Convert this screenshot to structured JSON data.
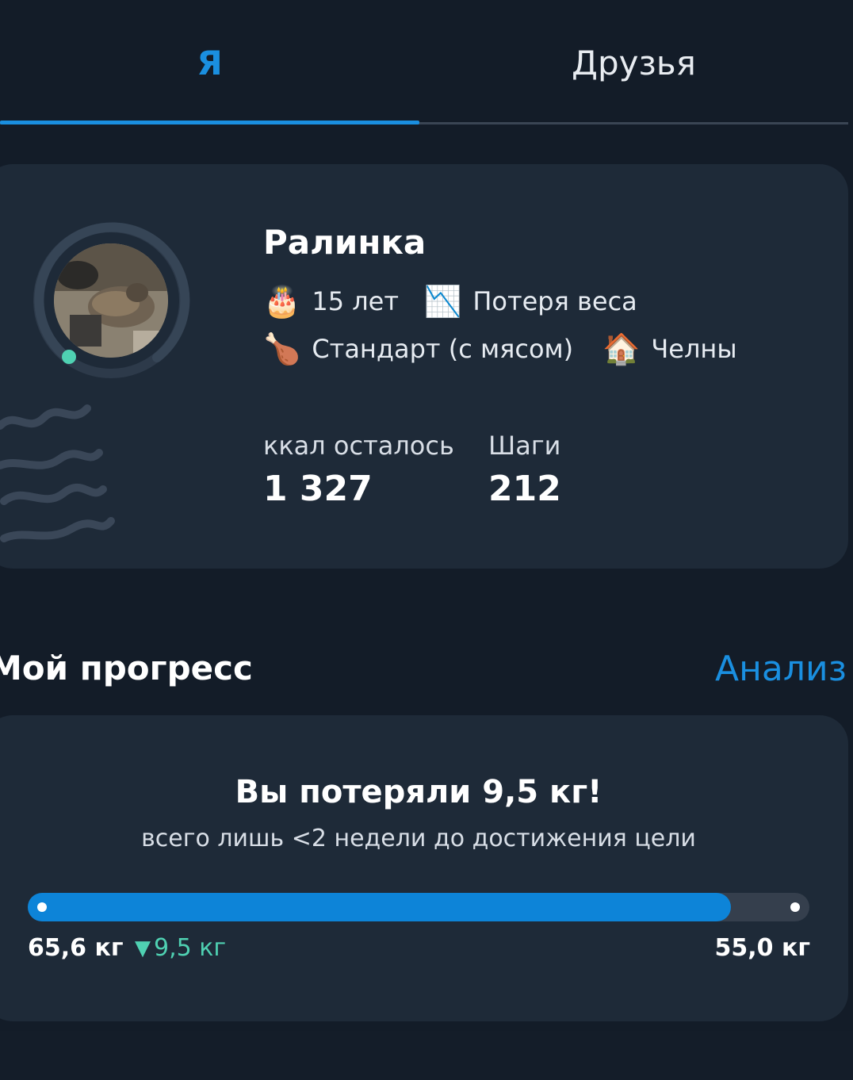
{
  "tabs": [
    {
      "label": "Я",
      "active": true
    },
    {
      "label": "Друзья",
      "active": false
    }
  ],
  "profile": {
    "name": "Ралинка",
    "online": true,
    "tags": {
      "age": {
        "icon": "🎂",
        "text": "15 лет"
      },
      "goal": {
        "icon": "📉",
        "text": "Потеря веса"
      },
      "diet": {
        "icon": "🍗",
        "text": "Стандарт (с мясом)"
      },
      "city": {
        "icon": "🏠",
        "text": "Челны"
      }
    },
    "stats": {
      "kcal_label": "ккал осталось",
      "kcal_value": "1 327",
      "steps_label": "Шаги",
      "steps_value": "212"
    }
  },
  "progress_section": {
    "title": "Мой прогресс",
    "link_label": "Анализ",
    "headline": "Вы потеряли 9,5 кг!",
    "subtitle": "всего лишь <2 недели до достижения цели",
    "progress_fraction": 0.9,
    "start_weight": "65,6 кг",
    "delta": "9,5 кг",
    "goal_weight": "55,0 кг"
  },
  "colors": {
    "accent": "#1a8fe0",
    "background": "#131c28",
    "card": "#1e2a38",
    "positive": "#4fd1b2"
  }
}
